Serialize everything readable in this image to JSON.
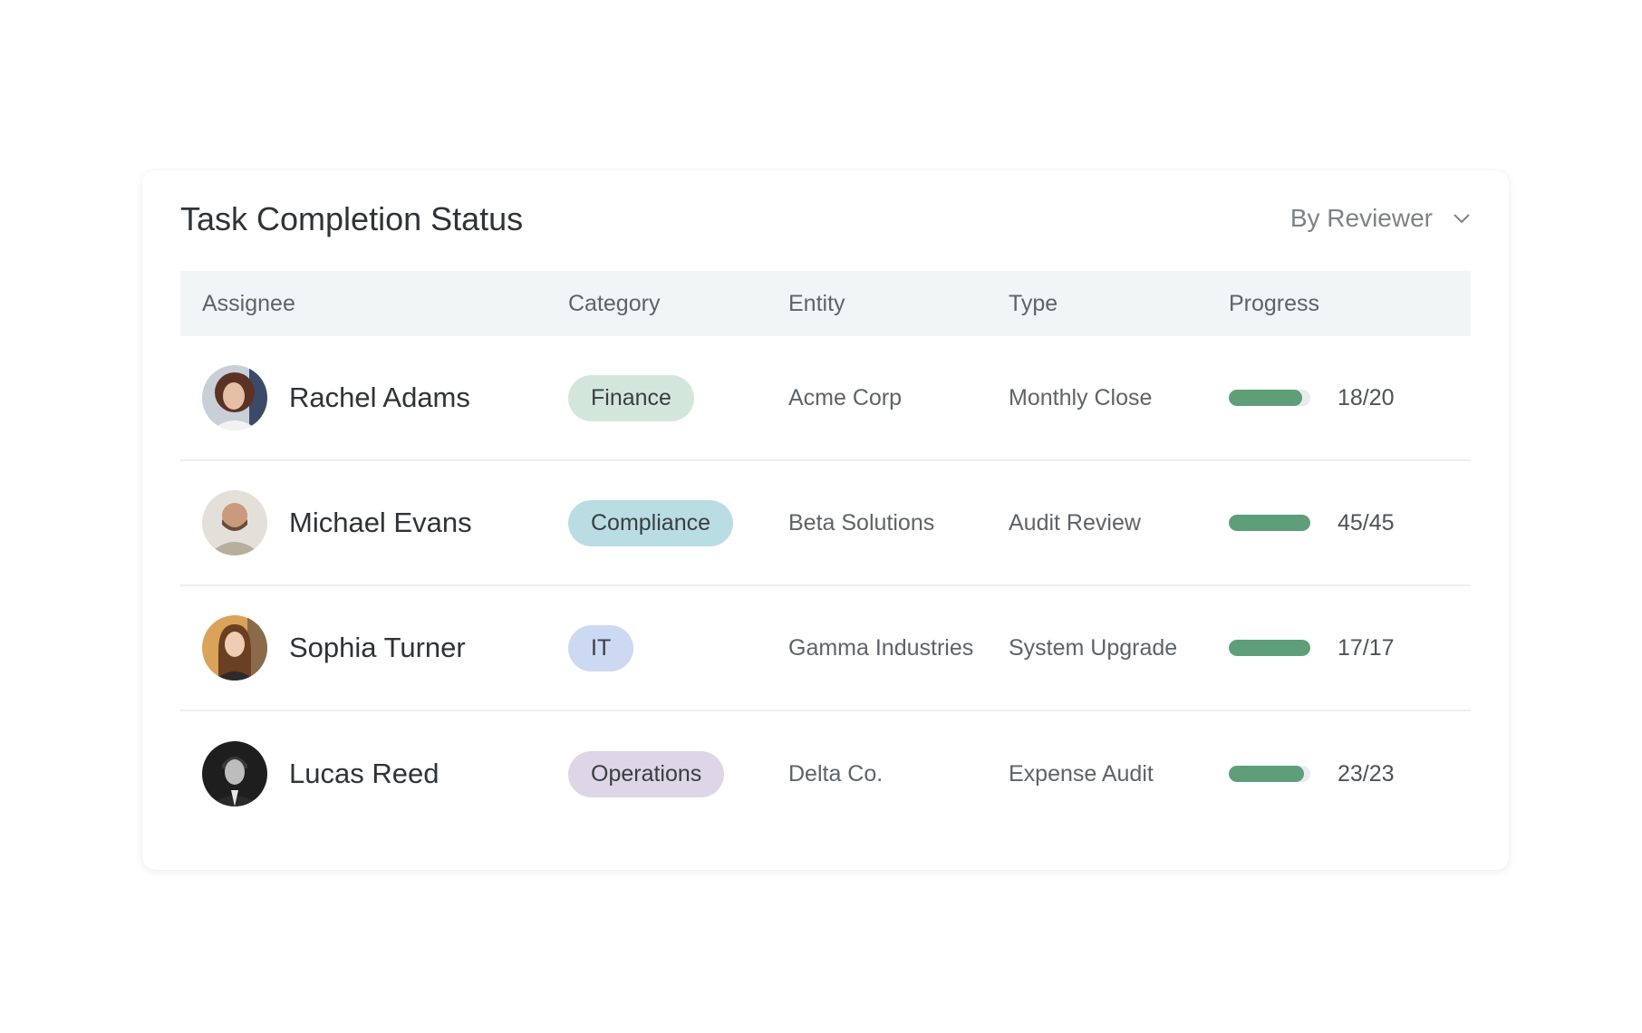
{
  "header": {
    "title": "Task Completion Status",
    "filter_label": "By Reviewer"
  },
  "columns": {
    "assignee": "Assignee",
    "category": "Category",
    "entity": "Entity",
    "type": "Type",
    "progress": "Progress"
  },
  "rows": [
    {
      "name": "Rachel Adams",
      "category": "Finance",
      "category_color": "#d3e6dc",
      "entity": "Acme Corp",
      "type": "Monthly Close",
      "progress": "18/20",
      "progress_fraction": 0.9
    },
    {
      "name": "Michael Evans",
      "category": "Compliance",
      "category_color": "#b9dde3",
      "entity": "Beta Solutions",
      "type": "Audit Review",
      "progress": "45/45",
      "progress_fraction": 1.0
    },
    {
      "name": "Sophia Turner",
      "category": "IT",
      "category_color": "#cdd8f2",
      "entity": "Gamma Industries",
      "type": "System Upgrade",
      "progress": "17/17",
      "progress_fraction": 1.0
    },
    {
      "name": "Lucas Reed",
      "category": "Operations",
      "category_color": "#ddd6e6",
      "entity": "Delta Co.",
      "type": "Expense Audit",
      "progress": "23/23",
      "progress_fraction": 0.92
    }
  ],
  "colors": {
    "progress_fill": "#5e9e78",
    "progress_track": "#e9ecec",
    "header_bg": "#f1f5f5"
  }
}
